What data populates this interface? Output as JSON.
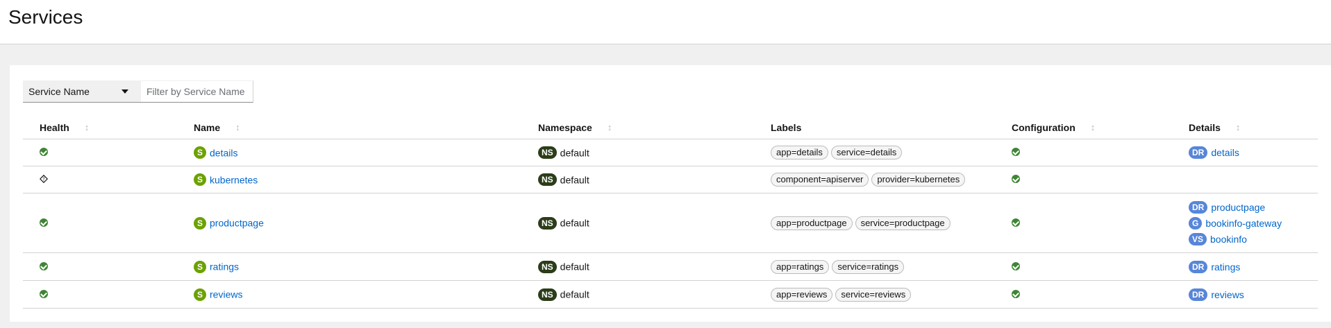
{
  "header": {
    "title": "Services"
  },
  "filter": {
    "field_label": "Service Name",
    "placeholder": "Filter by Service Name"
  },
  "table": {
    "columns": {
      "health": "Health",
      "name": "Name",
      "namespace": "Namespace",
      "labels": "Labels",
      "configuration": "Configuration",
      "details": "Details"
    },
    "rows": [
      {
        "health": "healthy",
        "name_badge": "S",
        "name": "details",
        "ns_badge": "NS",
        "namespace": "default",
        "labels": [
          "app=details",
          "service=details"
        ],
        "config": "valid",
        "details": [
          {
            "badge": "DR",
            "name": "details"
          }
        ]
      },
      {
        "health": "na",
        "name_badge": "S",
        "name": "kubernetes",
        "ns_badge": "NS",
        "namespace": "default",
        "labels": [
          "component=apiserver",
          "provider=kubernetes"
        ],
        "config": "valid",
        "details": []
      },
      {
        "health": "healthy",
        "name_badge": "S",
        "name": "productpage",
        "ns_badge": "NS",
        "namespace": "default",
        "labels": [
          "app=productpage",
          "service=productpage"
        ],
        "config": "valid",
        "details": [
          {
            "badge": "DR",
            "name": "productpage"
          },
          {
            "badge": "G",
            "name": "bookinfo-gateway"
          },
          {
            "badge": "VS",
            "name": "bookinfo"
          }
        ]
      },
      {
        "health": "healthy",
        "name_badge": "S",
        "name": "ratings",
        "ns_badge": "NS",
        "namespace": "default",
        "labels": [
          "app=ratings",
          "service=ratings"
        ],
        "config": "valid",
        "details": [
          {
            "badge": "DR",
            "name": "ratings"
          }
        ]
      },
      {
        "health": "healthy",
        "name_badge": "S",
        "name": "reviews",
        "ns_badge": "NS",
        "namespace": "default",
        "labels": [
          "app=reviews",
          "service=reviews"
        ],
        "config": "valid",
        "details": [
          {
            "badge": "DR",
            "name": "reviews"
          }
        ]
      }
    ]
  },
  "colors": {
    "service_badge": "#6ca100",
    "namespace_badge": "#2b3d19",
    "istio_badge": "#5786d9",
    "healthy": "#3e8635",
    "link": "#0066cc"
  }
}
